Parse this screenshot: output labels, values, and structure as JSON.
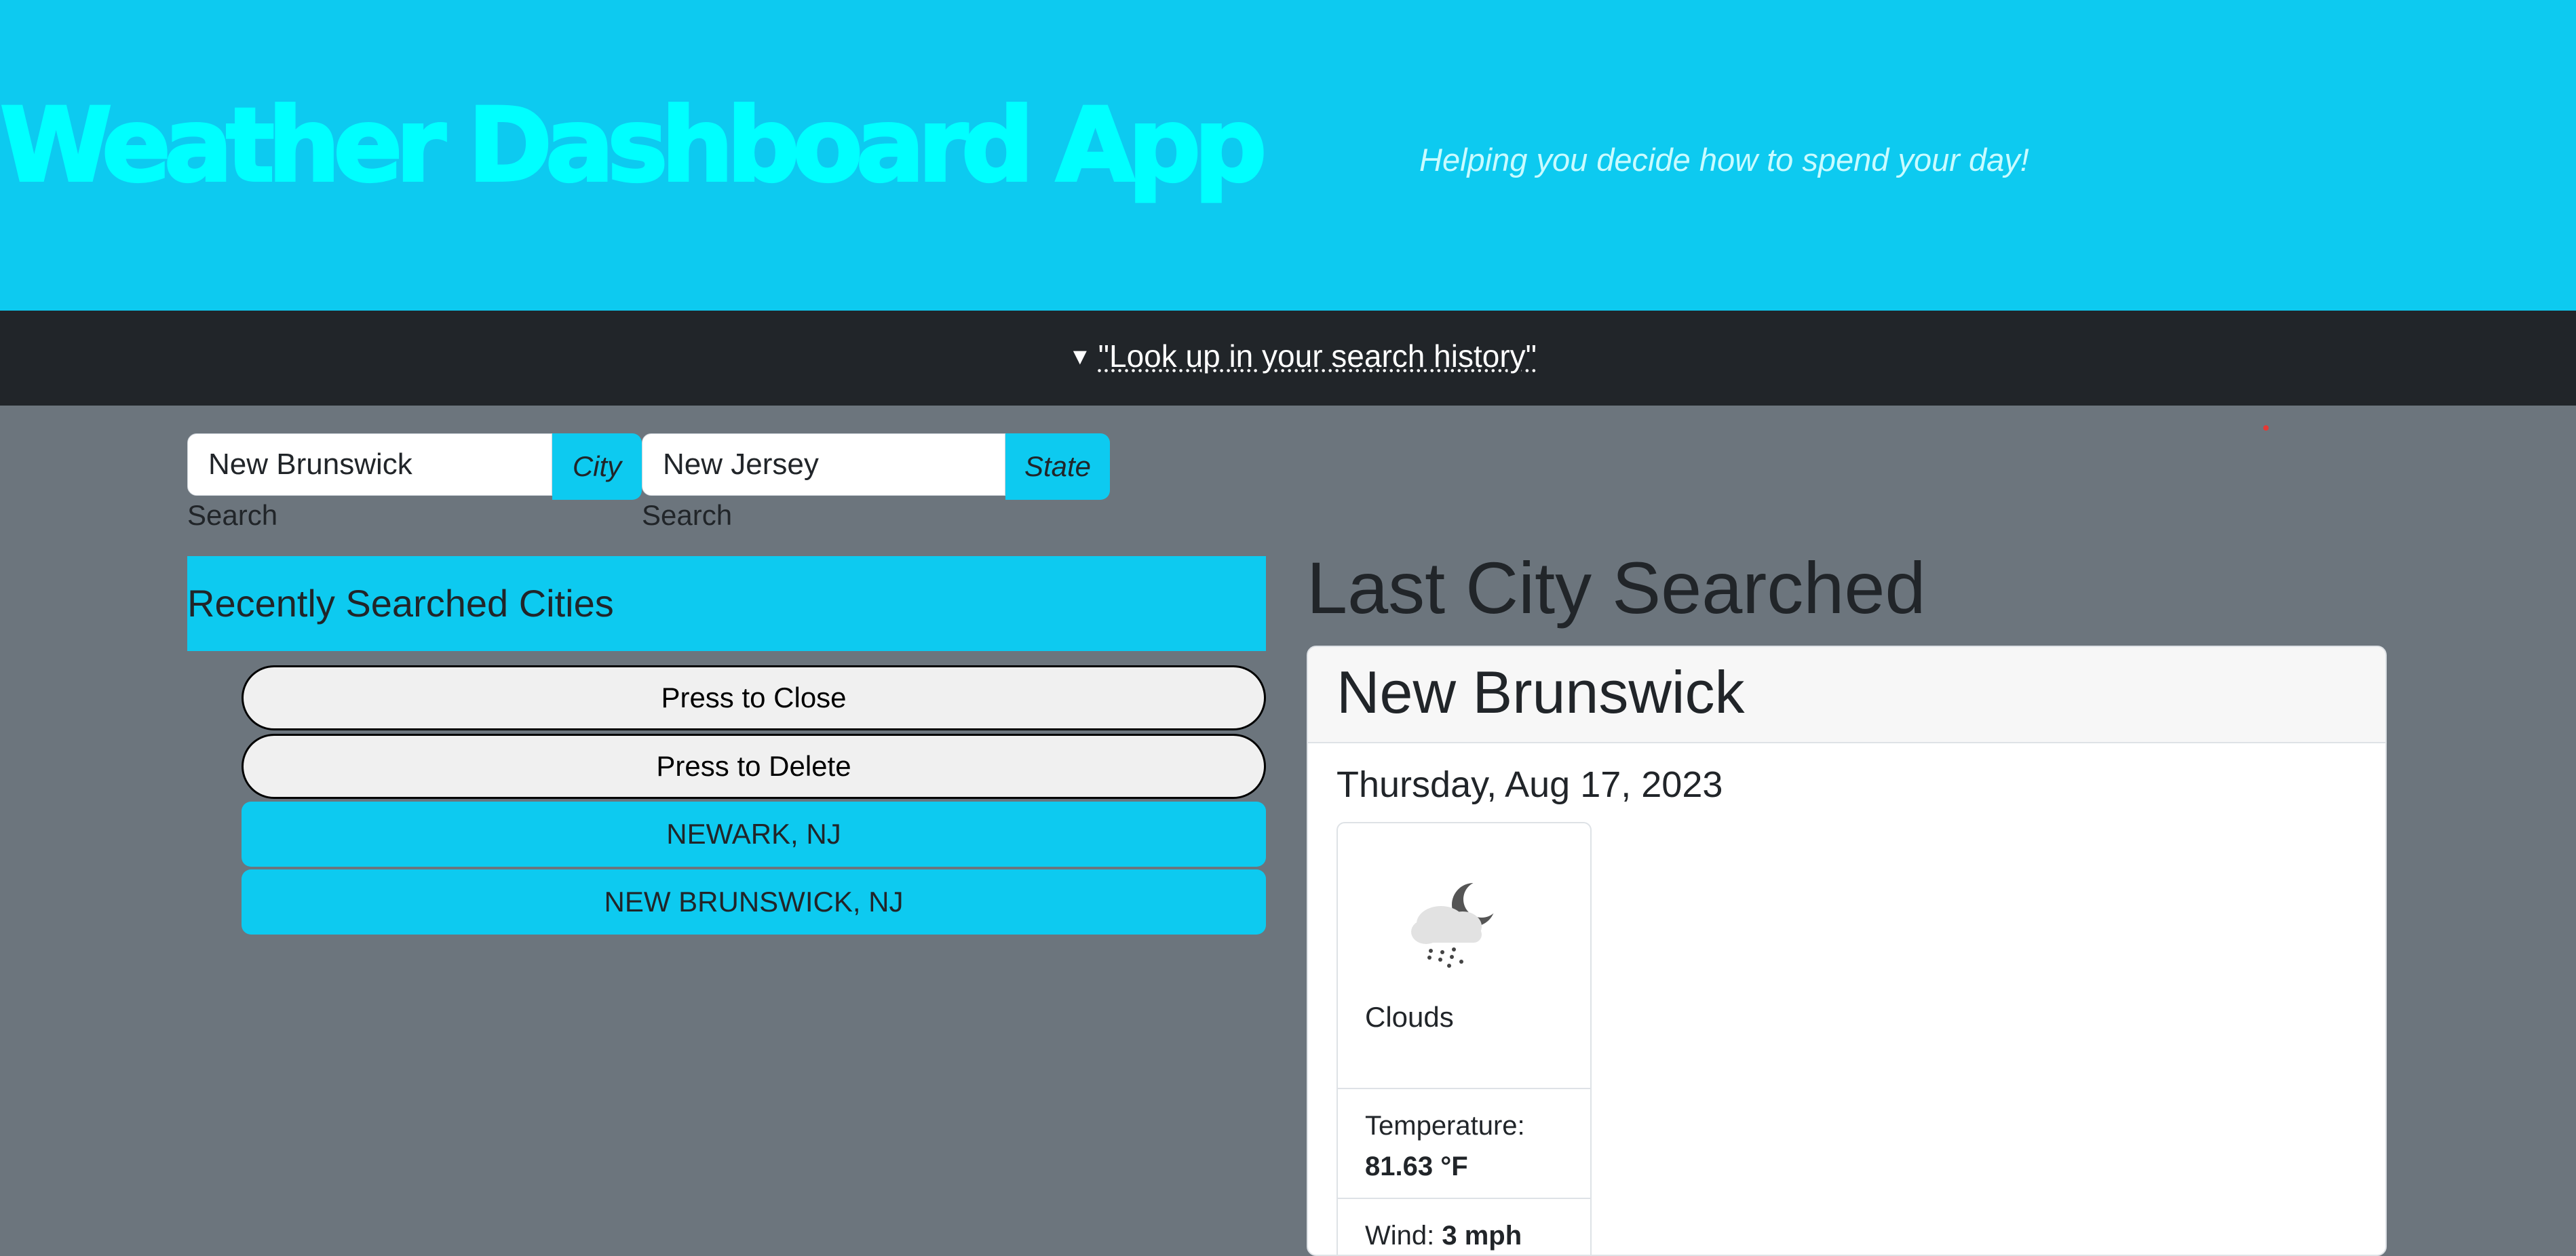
{
  "header": {
    "title": "Weather Dashboard App",
    "subtitle": "Helping you decide how to spend your day!"
  },
  "history": {
    "toggle_label": "\"Look up in your search history\""
  },
  "search": {
    "city_value": "New Brunswick",
    "city_addon": "City",
    "city_label": "Search",
    "state_value": "New Jersey",
    "state_addon": "State",
    "state_label": "Search"
  },
  "recent": {
    "heading": "Recently Searched Cities",
    "close_label": "Press to Close",
    "delete_label": "Press to Delete",
    "cities": [
      "NEWARK, NJ",
      "NEW BRUNSWICK, NJ"
    ]
  },
  "last": {
    "heading": "Last City Searched",
    "city": "New Brunswick",
    "date": "Thursday, Aug 17, 2023",
    "icon": "rain-cloud-moon-icon",
    "description": "Clouds",
    "temperature_label": "Temperature:",
    "temperature_value": "81.63 °F",
    "wind_label": "Wind:",
    "wind_value": "3 mph"
  },
  "colors": {
    "accent": "#0dcaf0",
    "title_text": "#00ffff",
    "page_bg": "#6c757d",
    "dark_bar": "#212529"
  }
}
